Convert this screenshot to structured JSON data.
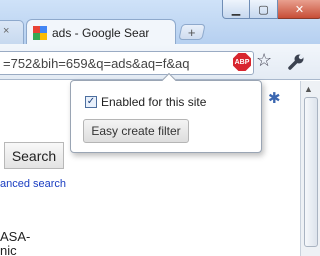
{
  "window": {
    "minimize_glyph": "▁",
    "maximize_glyph": "▢",
    "close_glyph": "✕"
  },
  "tabs": {
    "previous_tab_close": "×",
    "active_title": "ads - Google Sear",
    "new_tab_glyph": "+"
  },
  "toolbar": {
    "url": "=752&bih=659&q=ads&aq=f&aq",
    "extension_badge": "ABP",
    "star_glyph": "☆",
    "extension_color": "#d8262f"
  },
  "page": {
    "settings_glyph": "✱",
    "search_button": "Search",
    "advanced_search": "anced search",
    "result_line1": "ASA-",
    "result_line2": "nic",
    "link_color": "#1a3dc1"
  },
  "popup": {
    "checkbox_checked": true,
    "check_glyph": "✓",
    "enabled_label": "Enabled for this site",
    "filter_button": "Easy create filter"
  },
  "icons": {
    "favicon": "google-favicon",
    "extension": "adblock-plus-icon",
    "bookmark": "star-icon",
    "menu": "wrench-icon",
    "settings": "gear-icon"
  }
}
